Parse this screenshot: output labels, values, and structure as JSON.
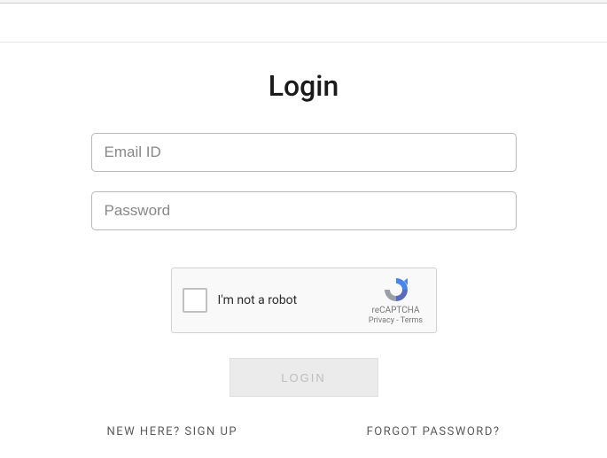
{
  "title": "Login",
  "form": {
    "email_placeholder": "Email ID",
    "password_placeholder": "Password"
  },
  "recaptcha": {
    "label": "I'm not a robot",
    "brand": "reCAPTCHA",
    "privacy": "Privacy",
    "terms": "Terms"
  },
  "login_button": "LOGIN",
  "links": {
    "signup": "NEW HERE? SIGN UP",
    "forgot": "FORGOT PASSWORD?"
  }
}
